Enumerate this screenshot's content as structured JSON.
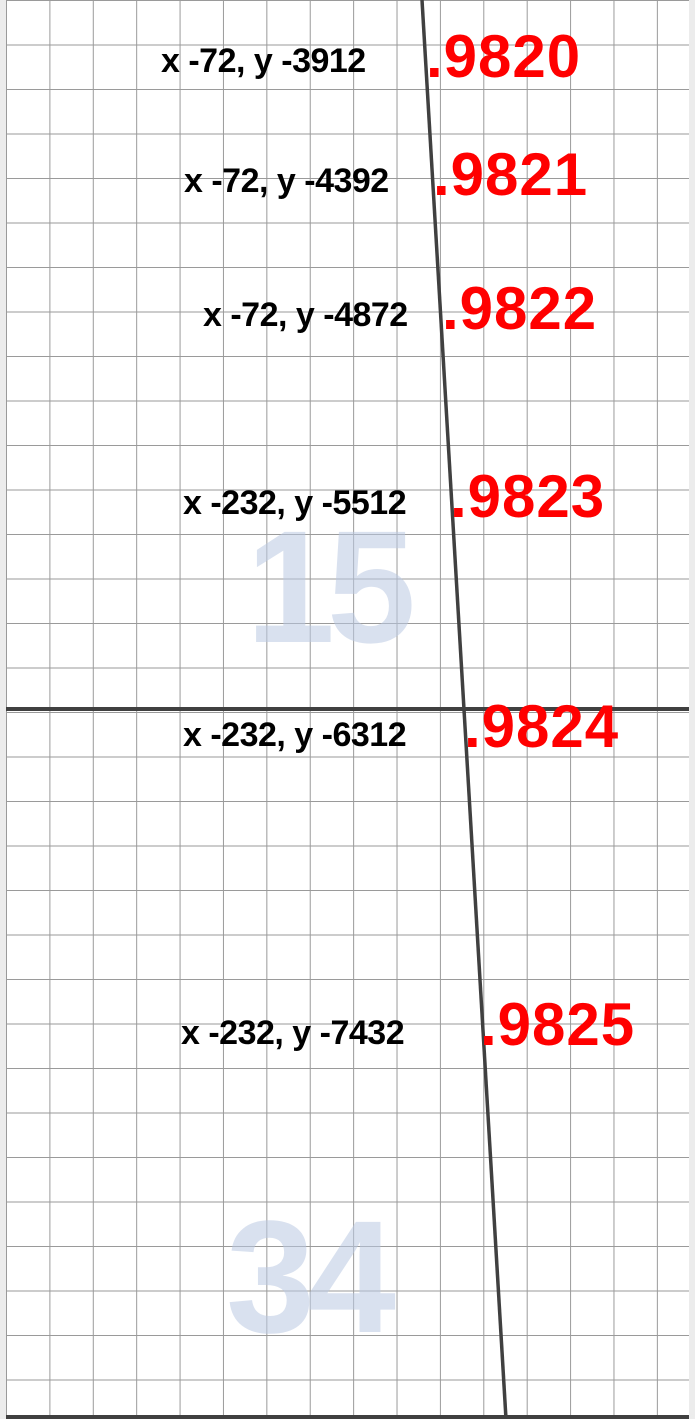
{
  "page_numbers": [
    "15",
    "34"
  ],
  "points": [
    {
      "coords": "x -72, y -3912",
      "reading": ".9820"
    },
    {
      "coords": "x -72, y -4392",
      "reading": ".9821"
    },
    {
      "coords": "x -72, y -4872",
      "reading": ".9822"
    },
    {
      "coords": "x -232, y -5512",
      "reading": ".9823"
    },
    {
      "coords": "x -232, y -6312",
      "reading": ".9824"
    },
    {
      "coords": "x -232, y -7432",
      "reading": ".9825"
    }
  ],
  "colors": {
    "reading": "#ff0000",
    "coords": "#000000",
    "grid": "#9a9a9a",
    "line": "#404040"
  }
}
